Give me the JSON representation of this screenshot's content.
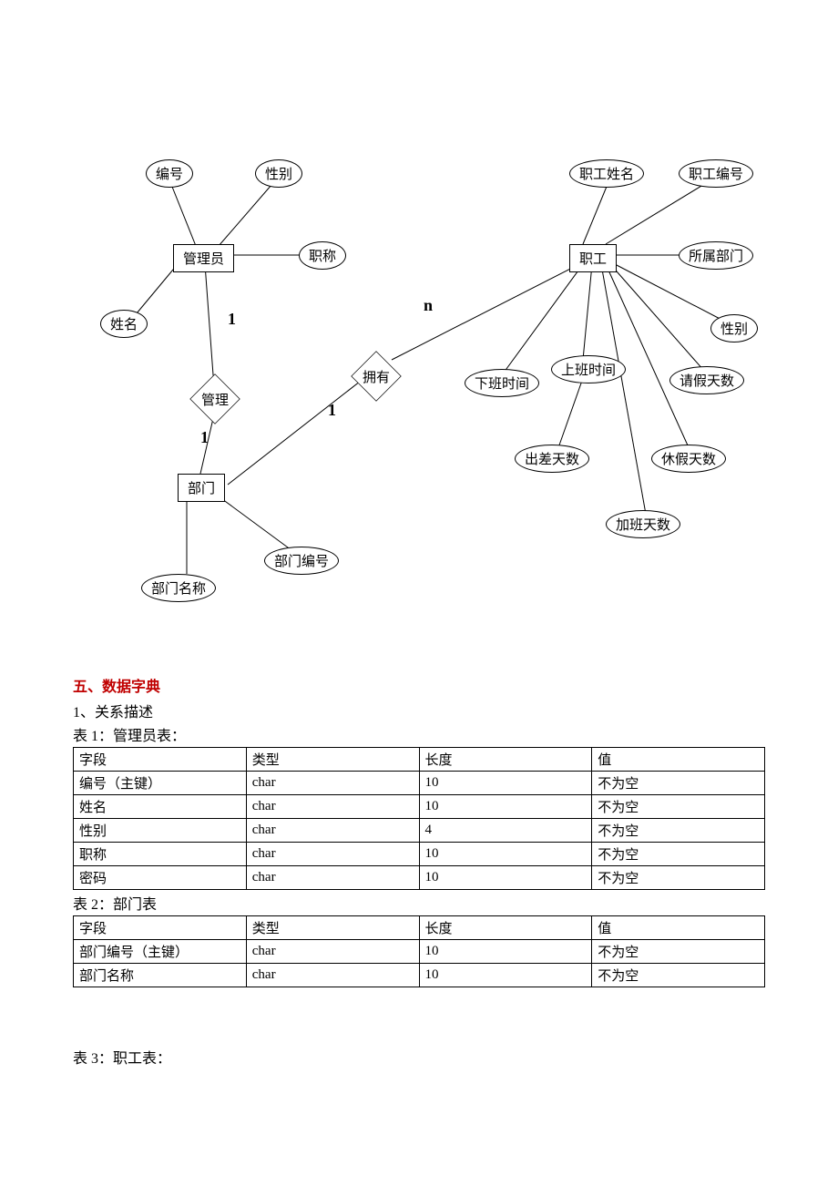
{
  "er": {
    "entities": {
      "admin": "管理员",
      "dept": "部门",
      "emp": "职工"
    },
    "relationships": {
      "manage": "管理",
      "own": "拥有"
    },
    "cardinalities": {
      "admin_manage": "1",
      "manage_dept": "1",
      "dept_own": "1",
      "own_emp": "n"
    },
    "attributes": {
      "admin_id": "编号",
      "admin_sex": "性别",
      "admin_title": "职称",
      "admin_name": "姓名",
      "dept_name": "部门名称",
      "dept_id": "部门编号",
      "emp_name": "职工姓名",
      "emp_id": "职工编号",
      "emp_dept": "所属部门",
      "emp_sex": "性别",
      "emp_leave": "请假天数",
      "emp_vac": "休假天数",
      "emp_ot": "加班天数",
      "emp_trip": "出差天数",
      "emp_off": "下班时间",
      "emp_on": "上班时间"
    }
  },
  "text": {
    "section_title": "五、数据字典",
    "sub1": "1、关系描述",
    "t1_caption": "表 1：管理员表：",
    "t2_caption": "表 2：部门表",
    "t3_caption": "表 3：职工表：",
    "headers": {
      "field": "字段",
      "type": "类型",
      "len": "长度",
      "val": "值"
    }
  },
  "tables": {
    "admin": [
      {
        "field": "编号（主键）",
        "type": "char",
        "len": "10",
        "val": "不为空"
      },
      {
        "field": "姓名",
        "type": "char",
        "len": "10",
        "val": "不为空"
      },
      {
        "field": "性别",
        "type": "char",
        "len": "4",
        "val": "不为空"
      },
      {
        "field": "职称",
        "type": "char",
        "len": "10",
        "val": "不为空"
      },
      {
        "field": "密码",
        "type": "char",
        "len": "10",
        "val": "不为空"
      }
    ],
    "dept": [
      {
        "field": "部门编号（主键）",
        "type": "char",
        "len": "10",
        "val": "不为空"
      },
      {
        "field": "部门名称",
        "type": "char",
        "len": "10",
        "val": "不为空"
      }
    ]
  }
}
